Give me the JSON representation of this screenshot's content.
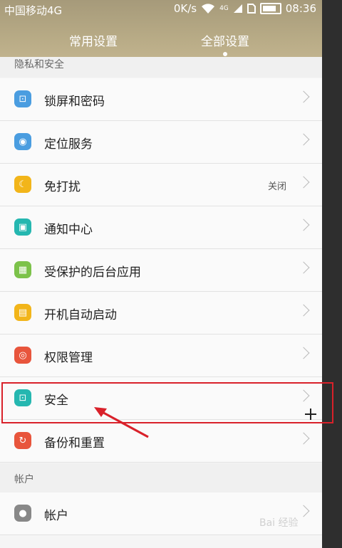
{
  "status_bar": {
    "carrier": "中国移动4G",
    "speed": "0K/s",
    "network": "4G",
    "time": "08:36"
  },
  "tabs": [
    {
      "label": "常用设置"
    },
    {
      "label": "全部设置"
    }
  ],
  "sections": [
    {
      "title": "隐私和安全"
    },
    {
      "title": "帐户"
    }
  ],
  "rows": [
    {
      "label": "锁屏和密码",
      "icon": "lock-icon",
      "color": "#4a9de0"
    },
    {
      "label": "定位服务",
      "icon": "location-icon",
      "color": "#4a9de0"
    },
    {
      "label": "免打扰",
      "icon": "moon-icon",
      "color": "#f2b51a",
      "value": "关闭"
    },
    {
      "label": "通知中心",
      "icon": "notification-icon",
      "color": "#25b7b0"
    },
    {
      "label": "受保护的后台应用",
      "icon": "apps-icon",
      "color": "#7cc24a"
    },
    {
      "label": "开机自动启动",
      "icon": "autostart-icon",
      "color": "#f2b51a"
    },
    {
      "label": "权限管理",
      "icon": "permission-icon",
      "color": "#e8553c"
    },
    {
      "label": "安全",
      "icon": "security-lock-icon",
      "color": "#25b7b0"
    },
    {
      "label": "备份和重置",
      "icon": "backup-icon",
      "color": "#e8553c"
    },
    {
      "label": "帐户",
      "icon": "user-icon",
      "color": "#888888"
    }
  ],
  "watermark": "Bai 经验"
}
